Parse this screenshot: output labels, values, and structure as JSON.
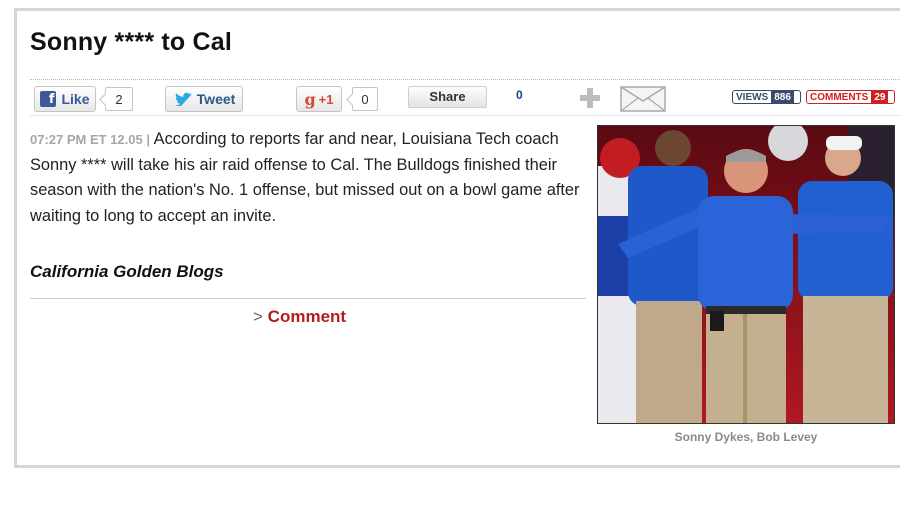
{
  "article": {
    "title": "Sonny **** to Cal",
    "timestamp": "07:27 PM ET 12.05 |",
    "body": "According to reports far and near, Louisiana Tech coach Sonny **** will take his air raid offense to Cal. The Bulldogs finished their season with the nation's No. 1 offense, but missed out on a bowl game after waiting to long to accept an invite.",
    "source": "California Golden Blogs",
    "comment_prefix": ">",
    "comment_link": "Comment"
  },
  "social": {
    "like_label": "Like",
    "like_count": "2",
    "tweet_label": "Tweet",
    "gplus_label": "+1",
    "gplus_count": "0",
    "share_label": "Share",
    "share_count": "0"
  },
  "stats": {
    "views_label": "VIEWS",
    "views_count": "886",
    "comments_label": "COMMENTS",
    "comments_count": "29"
  },
  "photo": {
    "caption": "Sonny Dykes, Bob Levey"
  },
  "colors": {
    "facebook": "#3b5998",
    "twitter": "#1da1f2",
    "gplus": "#d34836",
    "link_red": "#b71c1c",
    "views_bg": "#3a4a6a",
    "comments_bg": "#cc2222"
  },
  "icons": [
    "facebook-icon",
    "twitter-bird-icon",
    "google-plus-icon",
    "add-plus-icon",
    "email-envelope-icon"
  ]
}
